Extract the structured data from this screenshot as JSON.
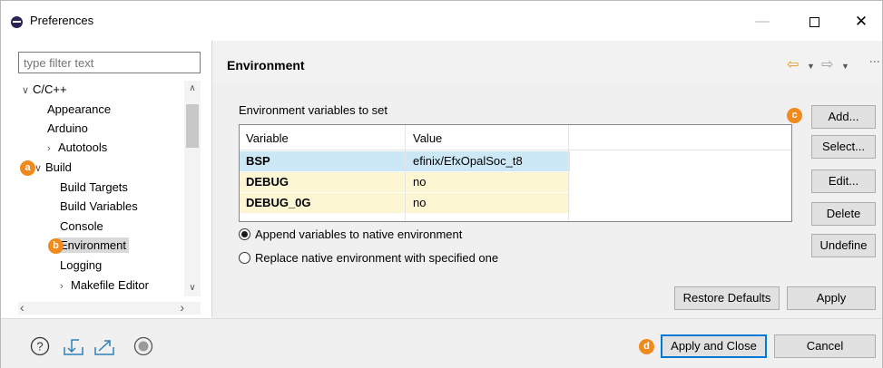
{
  "window": {
    "title": "Preferences",
    "minimize": "—",
    "close": "✕"
  },
  "sidebar": {
    "filter_placeholder": "type filter text",
    "tree": {
      "cc": "C/C++",
      "appearance": "Appearance",
      "arduino": "Arduino",
      "autotools": "Autotools",
      "build": "Build",
      "build_targets": "Build Targets",
      "build_variables": "Build Variables",
      "console": "Console",
      "environment": "Environment",
      "logging": "Logging",
      "makefile_editor": "Makefile Editor"
    }
  },
  "panel": {
    "title": "Environment",
    "group_label": "Environment variables to set",
    "table": {
      "headers": [
        "Variable",
        "Value"
      ],
      "rows": [
        {
          "variable": "BSP",
          "value": "efinix/EfxOpalSoc_t8"
        },
        {
          "variable": "DEBUG",
          "value": "no"
        },
        {
          "variable": "DEBUG_0G",
          "value": "no"
        }
      ]
    },
    "radio_append": "Append variables to native environment",
    "radio_replace": "Replace native environment with specified one",
    "buttons": {
      "add": "Add...",
      "select": "Select...",
      "edit": "Edit...",
      "delete": "Delete",
      "undefine": "Undefine",
      "restore_defaults": "Restore Defaults",
      "apply": "Apply"
    }
  },
  "footer": {
    "apply_and_close": "Apply and Close",
    "cancel": "Cancel"
  },
  "annotations": {
    "a": "a",
    "b": "b",
    "c": "c",
    "d": "d"
  },
  "colors": {
    "accent": "#0078d7",
    "badge": "#f08a1d",
    "selected_row": "#cce8f6",
    "user_row": "#fdf6d2"
  }
}
